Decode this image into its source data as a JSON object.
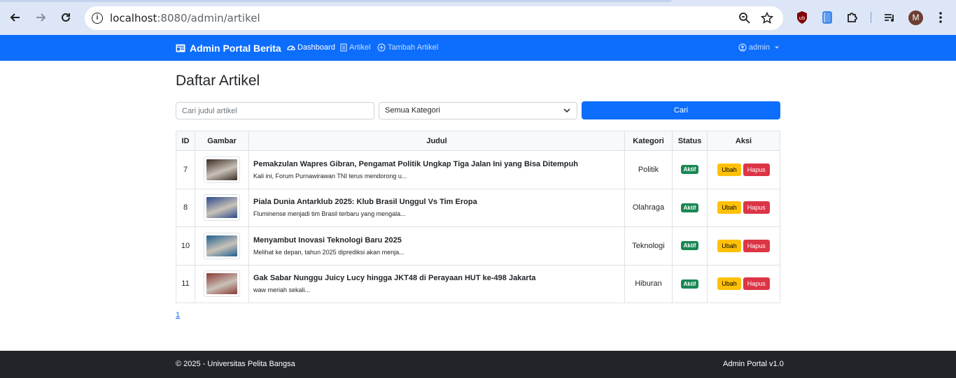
{
  "browser": {
    "url_host": "localhost",
    "url_path": ":8080/admin/artikel",
    "avatar_letter": "M"
  },
  "navbar": {
    "brand": "Admin Portal Berita",
    "links": [
      {
        "label": "Dashboard",
        "icon": "dashboard-icon"
      },
      {
        "label": "Artikel",
        "icon": "document-icon"
      },
      {
        "label": "Tambah Artikel",
        "icon": "plus-circle-icon"
      }
    ],
    "user": "admin"
  },
  "page": {
    "title": "Daftar Artikel",
    "search_placeholder": "Cari judul artikel",
    "category_selected": "Semua Kategori",
    "search_button": "Cari"
  },
  "table": {
    "headers": [
      "ID",
      "Gambar",
      "Judul",
      "Kategori",
      "Status",
      "Aksi"
    ],
    "rows": [
      {
        "id": "7",
        "title": "Pemakzulan Wapres Gibran, Pengamat Politik Ungkap Tiga Jalan Ini yang Bisa Ditempuh",
        "excerpt": "Kali ini, Forum Purnawirawan TNI terus mendorong u...",
        "category": "Politik",
        "status": "Aktif",
        "edit": "Ubah",
        "delete": "Hapus",
        "thumb_color": "#3a2a22"
      },
      {
        "id": "8",
        "title": "Piala Dunia Antarklub 2025: Klub Brasil Unggul Vs Tim Eropa",
        "excerpt": "Fluminense menjadi tim Brasil terbaru yang mengala...",
        "category": "Olahraga",
        "status": "Aktif",
        "edit": "Ubah",
        "delete": "Hapus",
        "thumb_color": "#2c4a8a"
      },
      {
        "id": "10",
        "title": "Menyambut Inovasi Teknologi Baru 2025",
        "excerpt": "Melihat ke depan, tahun 2025 diprediksi akan menja...",
        "category": "Teknologi",
        "status": "Aktif",
        "edit": "Ubah",
        "delete": "Hapus",
        "thumb_color": "#1f5f8f"
      },
      {
        "id": "11",
        "title": "Gak Sabar Nunggu Juicy Lucy hingga JKT48 di Perayaan HUT ke-498 Jakarta",
        "excerpt": "waw meriah sekali...",
        "category": "Hiburan",
        "status": "Aktif",
        "edit": "Ubah",
        "delete": "Hapus",
        "thumb_color": "#8a3a34"
      }
    ]
  },
  "pagination": {
    "page": "1"
  },
  "footer": {
    "left": "© 2025 - Universitas Pelita Bangsa",
    "right": "Admin Portal v1.0"
  },
  "colors": {
    "primary": "#0d6efd",
    "success": "#198754",
    "warning": "#ffc107",
    "danger": "#dc3545",
    "footer": "#212529"
  }
}
